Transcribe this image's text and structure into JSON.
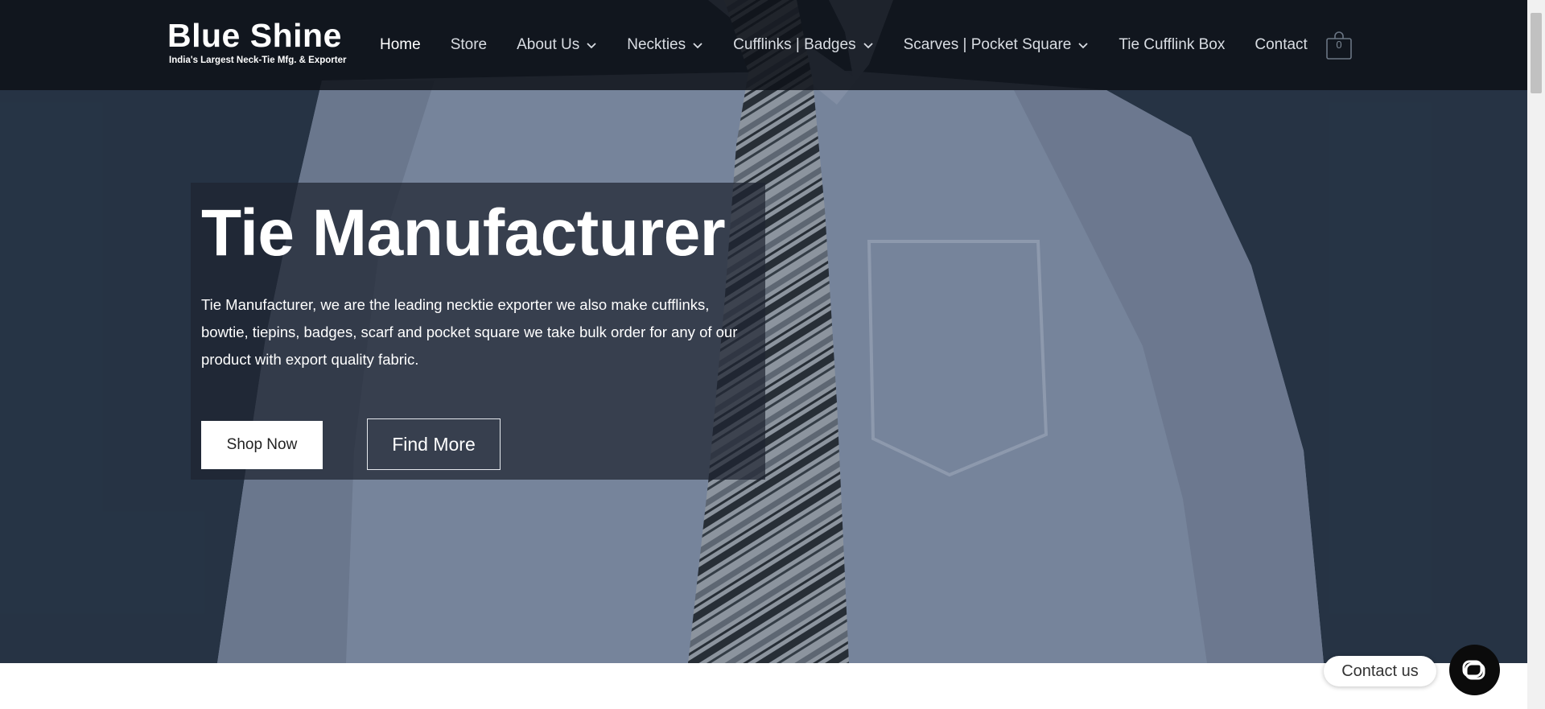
{
  "brand": {
    "name": "Blue Shine",
    "tagline": "India's Largest Neck-Tie Mfg. & Exporter"
  },
  "nav": {
    "items": [
      {
        "label": "Home",
        "active": true,
        "dropdown": false
      },
      {
        "label": "Store",
        "active": false,
        "dropdown": false
      },
      {
        "label": "About Us",
        "active": false,
        "dropdown": true
      },
      {
        "label": "Neckties",
        "active": false,
        "dropdown": true
      },
      {
        "label": "Cufflinks | Badges",
        "active": false,
        "dropdown": true
      },
      {
        "label": "Scarves | Pocket Square",
        "active": false,
        "dropdown": true
      },
      {
        "label": "Tie Cufflink Box",
        "active": false,
        "dropdown": false
      },
      {
        "label": "Contact",
        "active": false,
        "dropdown": false
      }
    ],
    "cart_count": "0"
  },
  "hero": {
    "title": "Tie Manufacturer",
    "description": "Tie Manufacturer, we are the leading necktie exporter we also make cufflinks, bowtie, tiepins, badges, scarf and pocket square we take bulk order for any of our product with export quality fabric.",
    "shop_button": "Shop Now",
    "find_button": "Find More"
  },
  "contact_widget": {
    "label": "Contact us"
  },
  "colors": {
    "header_bg": "#0e1218",
    "hero_bg": "#2a3849",
    "shirt": "#8f9db5",
    "tie_dark": "#2b3138",
    "tie_light": "#a9b0b8"
  }
}
